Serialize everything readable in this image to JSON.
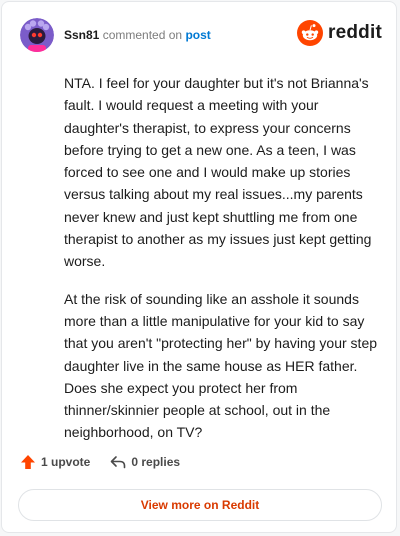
{
  "header": {
    "username": "Ssn81",
    "commented_on": "commented on",
    "post_link": "post",
    "brand": "reddit"
  },
  "comment": {
    "paragraphs": [
      "NTA. I feel for your daughter but it's not Brianna's fault. I would request a meeting with your daughter's therapist, to express your concerns before trying to get a new one. As a teen, I was forced to see one and I would make up stories versus talking about my real issues...my parents never knew and just kept shuttling me from one therapist to another as my issues just kept getting worse.",
      "At the risk of sounding like an asshole it sounds more than a little manipulative for your kid to say that you aren't \"protecting her\" by having your step daughter live in the same house as HER father. Does she expect you protect her from thinner/skinnier people at school, out in the neighborhood, on TV?"
    ]
  },
  "actions": {
    "upvotes": "1 upvote",
    "replies": "0 replies"
  },
  "footer": {
    "view_more": "View more on Reddit"
  },
  "colors": {
    "brand": "#ff4500",
    "link": "#0079d3",
    "cta": "#d93a00"
  }
}
